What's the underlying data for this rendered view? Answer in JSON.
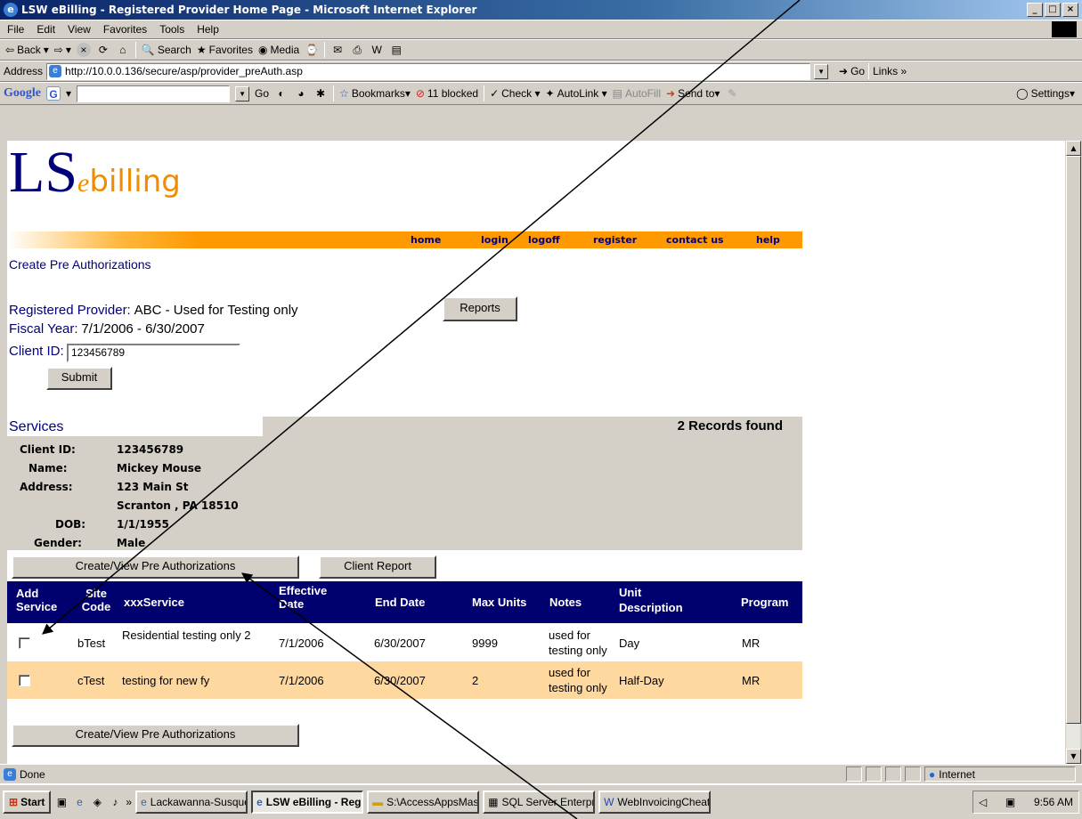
{
  "window": {
    "title": "LSW eBilling - Registered Provider Home Page - Microsoft Internet Explorer",
    "minimize": "_",
    "maximize": "□",
    "close": "×"
  },
  "menu": [
    "File",
    "Edit",
    "View",
    "Favorites",
    "Tools",
    "Help"
  ],
  "toolbar": {
    "back": "Back",
    "search": "Search",
    "favorites": "Favorites",
    "media": "Media"
  },
  "address": {
    "label": "Address",
    "url": "http://10.0.0.136/secure/asp/provider_preAuth.asp",
    "go": "Go",
    "links": "Links »"
  },
  "googlebar": {
    "logo": "Google",
    "go": "Go",
    "bookmarks": "Bookmarks▾",
    "blocked": "11 blocked",
    "check": "Check ▾",
    "autolink": "AutoLink ▾",
    "autofill": "AutoFill",
    "sendto": "Send to▾",
    "settings": "Settings▾"
  },
  "logo": {
    "main": "LS",
    "e": "e",
    "billing": "billing"
  },
  "nav": [
    "home",
    "login",
    "logoff",
    "register",
    "contact us",
    "help"
  ],
  "page": {
    "title": "Create Pre Authorizations",
    "provider_label": "Registered Provider:",
    "provider_value": "ABC - Used for Testing only",
    "fiscal_label": "Fiscal Year:",
    "fiscal_value": "7/1/2006 - 6/30/2007",
    "client_label": "Client ID:",
    "client_input": "123456789",
    "reports_button": "Reports",
    "submit_button": "Submit"
  },
  "services": {
    "title": "Services",
    "records": "2 Records found",
    "client": [
      {
        "label": "Client ID:",
        "value": "123456789"
      },
      {
        "label": "Name:",
        "value": "Mickey Mouse"
      },
      {
        "label": "Address:",
        "value": "123 Main St"
      },
      {
        "label": "",
        "value": "Scranton , PA 18510"
      },
      {
        "label": "DOB:",
        "value": "1/1/1955"
      },
      {
        "label": "Gender:",
        "value": "Male"
      }
    ],
    "create_view_button": "Create/View Pre Authorizations",
    "client_report_button": "Client Report"
  },
  "grid": {
    "headers": [
      "Add Service",
      "Site Code",
      "xxxService",
      "Effective Date",
      "End Date",
      "Max Units",
      "Notes",
      "Unit Description",
      "Program"
    ],
    "rows": [
      {
        "site": "bTest",
        "service": "Residential testing only 2",
        "effective": "7/1/2006",
        "end": "6/30/2007",
        "max": "9999",
        "notes": "used for testing only",
        "unit": "Day",
        "program": "MR",
        "bg": "#ffffff"
      },
      {
        "site": "cTest",
        "service": "testing for new fy",
        "effective": "7/1/2006",
        "end": "6/30/2007",
        "max": "2",
        "notes": "used for testing only",
        "unit": "Half-Day",
        "program": "MR",
        "bg": "#ffd8a0"
      }
    ],
    "bottom_button": "Create/View Pre Authorizations"
  },
  "status": {
    "text": "Done",
    "zone": "Internet"
  },
  "taskbar": {
    "start": "Start",
    "chevron": "»",
    "tasks": [
      "Lackawanna-Susque...",
      "LSW eBilling - Regi...",
      "S:\\AccessAppsMaste...",
      "SQL Server Enterpris...",
      "WebInvoicingCheatS..."
    ],
    "clock": "9:56 AM"
  },
  "colors": {
    "navy": "#00007a",
    "orange": "#ff9900",
    "header": "#00006e",
    "altrow": "#ffd8a0"
  }
}
